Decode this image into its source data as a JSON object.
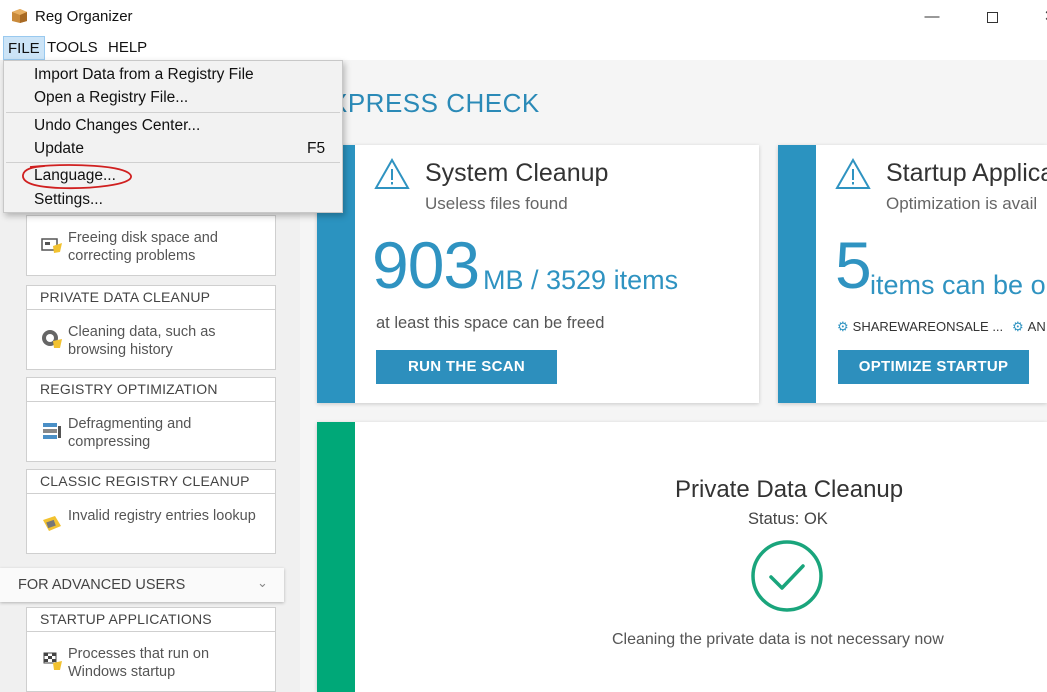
{
  "window": {
    "title": "Reg Organizer",
    "minimize": "—",
    "close": "✕"
  },
  "menubar": {
    "file": "FILE",
    "tools": "TOOLS",
    "help": "HELP"
  },
  "file_menu": {
    "items": [
      {
        "label": "Import Data from a Registry File"
      },
      {
        "label": "Open a Registry File..."
      },
      {
        "label": "Undo Changes Center..."
      },
      {
        "label": "Update",
        "shortcut": "F5"
      },
      {
        "label": "Language..."
      },
      {
        "label": "Settings..."
      }
    ]
  },
  "sidebar": {
    "top_card": {
      "text": "Freeing disk space and correcting problems",
      "icon": "disk-cleanup-icon"
    },
    "cards": [
      {
        "title": "PRIVATE DATA CLEANUP",
        "text": "Cleaning data, such as browsing history",
        "icon": "privacy-broom-icon"
      },
      {
        "title": "REGISTRY OPTIMIZATION",
        "text": "Defragmenting and compressing",
        "icon": "registry-defrag-icon"
      },
      {
        "title": "CLASSIC REGISTRY CLEANUP",
        "text": "Invalid registry entries lookup",
        "icon": "registry-clean-icon"
      }
    ],
    "advanced": {
      "label": "FOR ADVANCED USERS"
    },
    "advanced_cards": [
      {
        "title": "STARTUP APPLICATIONS",
        "text": "Processes that run on Windows startup",
        "icon": "startup-flag-icon"
      }
    ]
  },
  "main": {
    "express_title": "XPRESS CHECK",
    "system_cleanup": {
      "title": "System Cleanup",
      "subtitle": "Useless files found",
      "big_number": "903",
      "unit": "MB / 3529 items",
      "note": "at least this space can be freed",
      "button": "RUN THE SCAN",
      "bar_color": "#2b93c0"
    },
    "startup": {
      "title": "Startup Applica",
      "subtitle": "Optimization is avail",
      "big_number": "5",
      "unit": "items can be opti",
      "tags": [
        "SHAREWAREONSALE ...",
        "AN"
      ],
      "button": "OPTIMIZE STARTUP",
      "bar_color": "#2b93c0"
    },
    "private_data": {
      "title": "Private Data Cleanup",
      "status": "Status: OK",
      "note": "Cleaning the private data is not necessary now",
      "bar_color": "#00a878",
      "check_color": "#1aa57c"
    }
  }
}
